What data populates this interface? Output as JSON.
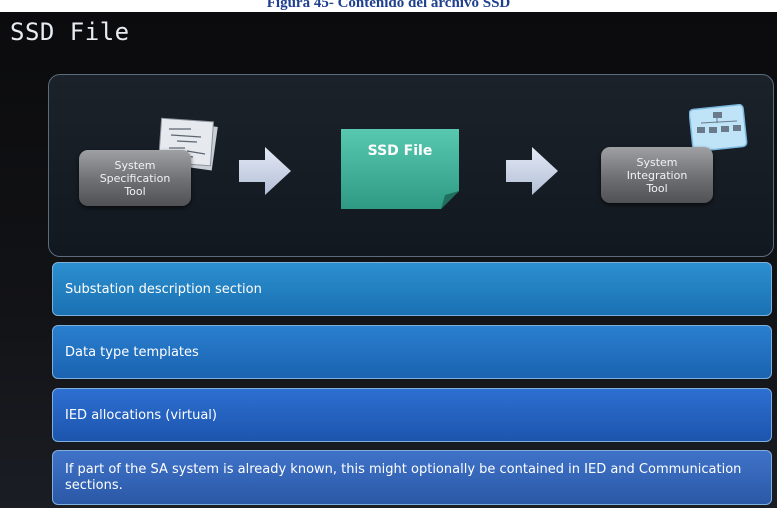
{
  "caption": "Figura 45- Contenido del archivo SSD",
  "slide": {
    "title": "SSD File",
    "flow": {
      "spec_tool_label": "System\nSpecification\nTool",
      "ssd_file_label": "SSD File",
      "integration_tool_label": "System\nIntegration\nTool"
    },
    "sections": [
      "Substation description section",
      "Data type templates",
      "IED allocations (virtual)",
      "If part of the SA system is already known,  this might optionally be contained in IED and Communication sections."
    ]
  },
  "colors": {
    "slide_background": "#0b0b0d",
    "ssd_file_teal": "#3fb59e",
    "section_blue": "#1a71b2",
    "caption_blue": "#1f3f8f"
  }
}
